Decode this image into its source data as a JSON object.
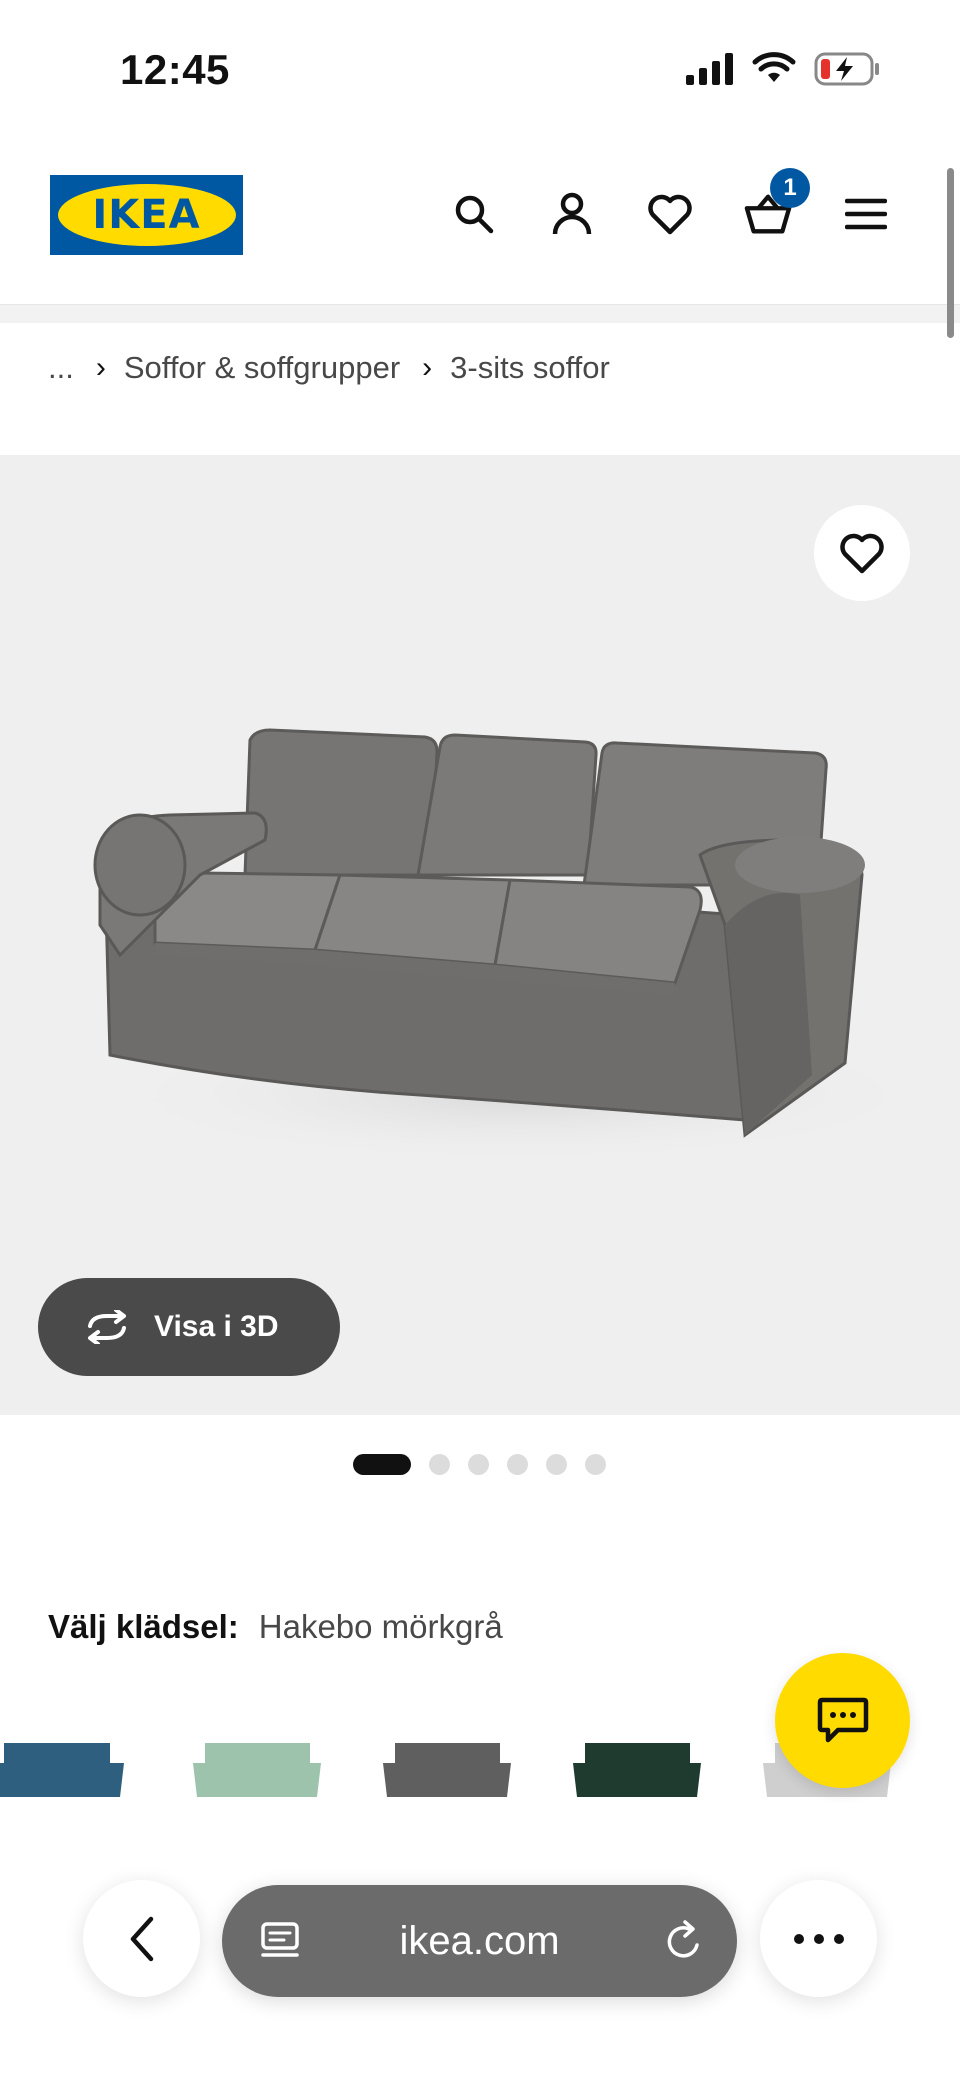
{
  "status_bar": {
    "time": "12:45"
  },
  "header": {
    "logo_text": "IKEA",
    "cart_count": "1",
    "icons": [
      "search-icon",
      "account-icon",
      "heart-icon",
      "cart-icon",
      "menu-icon"
    ]
  },
  "breadcrumb": {
    "items": [
      "...",
      "Soffor & soffgrupper",
      "3-sits soffor"
    ]
  },
  "product_image": {
    "view_3d_label": "Visa i 3D",
    "image_count": 6,
    "active_image": 1
  },
  "upholstery": {
    "label": "Välj klädsel:",
    "value": "Hakebo mörkgrå",
    "swatch_colors": [
      "#2e5f7e",
      "#9ec3ad",
      "#5f5f5f",
      "#1f3a2e",
      "#cfcfcf"
    ]
  },
  "browser": {
    "url": "ikea.com"
  },
  "colors": {
    "ikea_blue": "#0058a3",
    "ikea_yellow": "#ffdb00",
    "sofa_grey": "#7d7c7a"
  }
}
